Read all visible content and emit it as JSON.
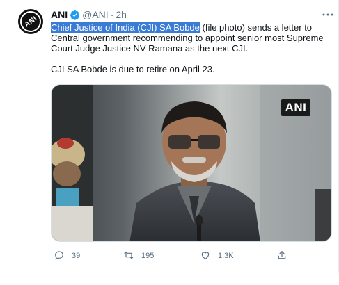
{
  "tweet": {
    "author_name": "ANI",
    "avatar_text": "ANI",
    "handle": "@ANI",
    "separator": "·",
    "time": "2h",
    "text_highlight": "Chief Justice of India (CJI) SA Bobde",
    "text_rest": " (file photo) sends a letter to Central government recommending to appoint senior most Supreme Court Judge Justice NV Ramana as the next CJI.",
    "text_para2": "CJI SA Bobde is due to retire on April 23.",
    "media_watermark": "ANI"
  },
  "actions": {
    "reply_count": "39",
    "retweet_count": "195",
    "like_count": "1.3K"
  },
  "icons": {
    "verified": "verified-badge-icon",
    "more": "more-dots-icon",
    "reply": "reply-icon",
    "retweet": "retweet-icon",
    "like": "like-icon",
    "share": "share-icon"
  },
  "colors": {
    "accent": "#1d9bf0",
    "highlight": "#3a7bd5",
    "muted": "#5b7083"
  }
}
